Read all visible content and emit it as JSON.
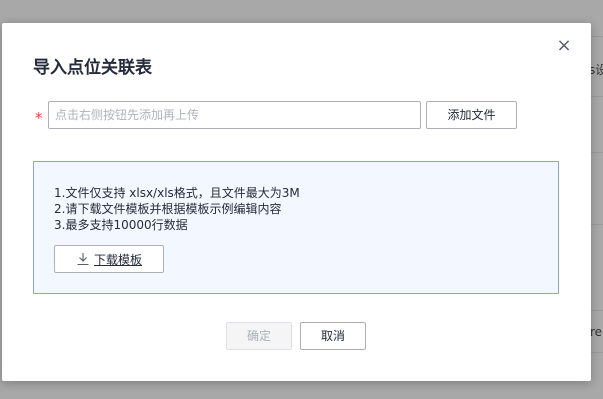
{
  "background": {
    "right_text_1": "s设",
    "right_text_2": "re"
  },
  "modal": {
    "title": "导入点位关联表",
    "close_label": "×",
    "required_mark": "*",
    "file_input": {
      "placeholder": "点击右侧按钮先添加再上传",
      "value": ""
    },
    "add_file_label": "添加文件",
    "info": {
      "lines": [
        "1.文件仅支持 xlsx/xls格式，且文件最大为3M",
        "2.请下载文件模板并根据模板示例编辑内容",
        "3.最多支持10000行数据"
      ],
      "download_label": "下载模板",
      "download_icon": "download-icon"
    },
    "confirm_label": "确定",
    "cancel_label": "取消"
  }
}
